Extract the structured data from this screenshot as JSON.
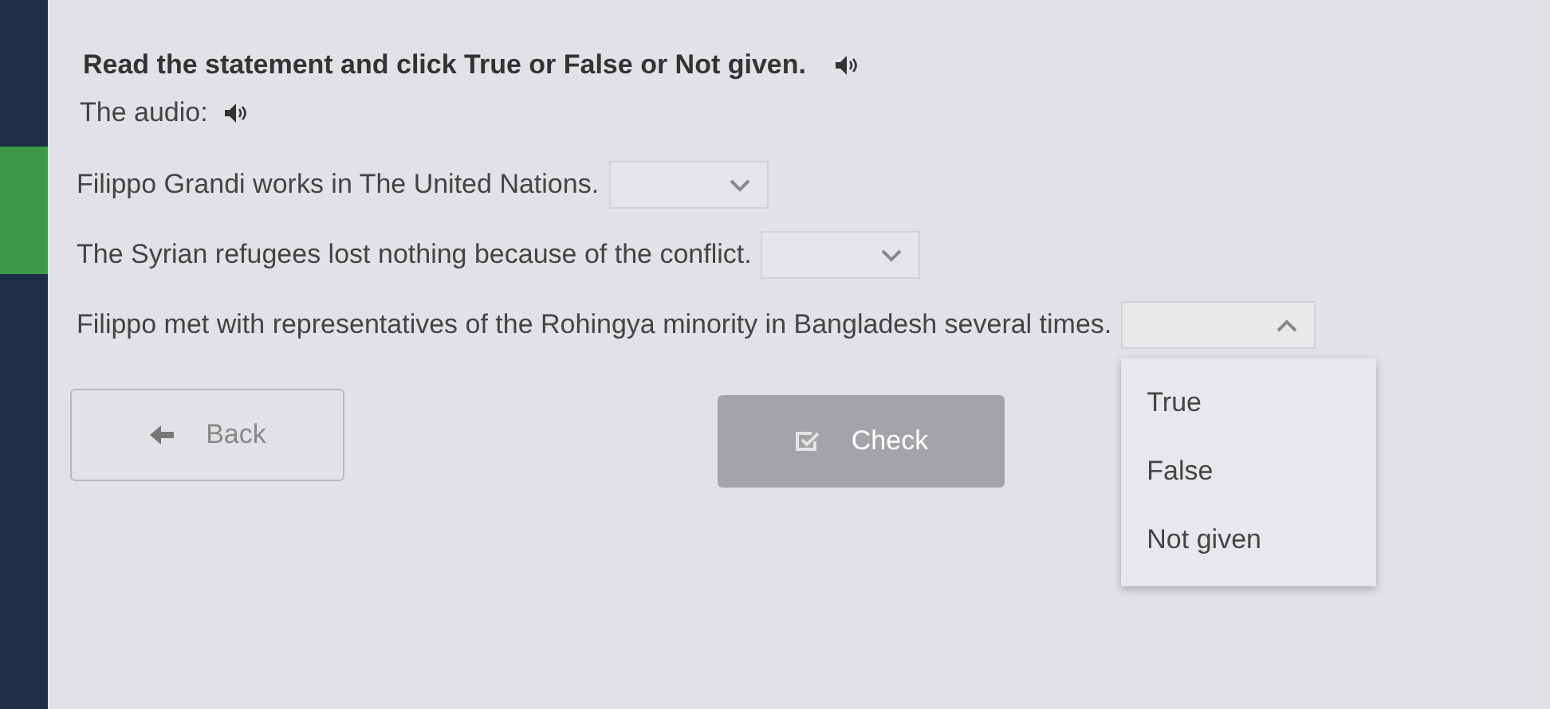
{
  "instruction": {
    "text": "Read the statement and click True or False or Not given."
  },
  "audio_label": "The audio:",
  "questions": [
    {
      "statement": "Filippo Grandi works in The United Nations.",
      "dropdown": {
        "expanded": false
      }
    },
    {
      "statement": "The Syrian refugees lost nothing because of the conflict.",
      "dropdown": {
        "expanded": false
      }
    },
    {
      "statement": "Filippo met with representatives of the Rohingya minority in Bangladesh several times.",
      "dropdown": {
        "expanded": true,
        "options": [
          "True",
          "False",
          "Not given"
        ]
      }
    }
  ],
  "buttons": [
    {
      "kind": "back",
      "label": "Back"
    },
    {
      "kind": "check",
      "label": "Check",
      "disabled": true
    }
  ]
}
